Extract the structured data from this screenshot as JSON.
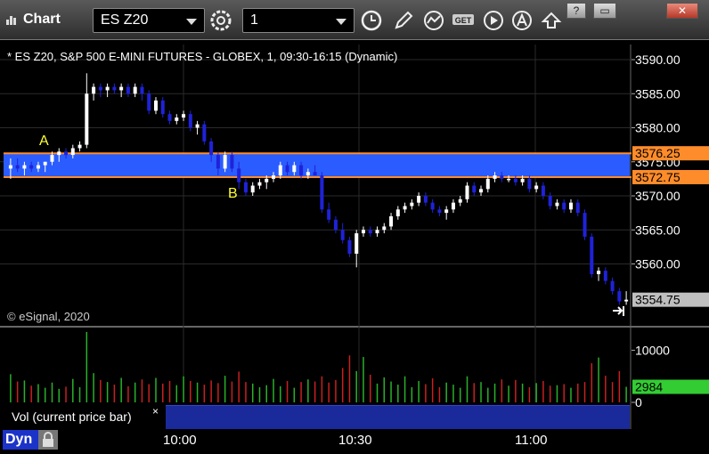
{
  "window": {
    "title": "Chart",
    "symbol_combo": "ES Z20",
    "interval_combo": "1",
    "buttons": [
      "gear-icon",
      "clock-icon",
      "pencil-icon",
      "study-icon",
      "get-icon",
      "play-icon",
      "a-icon",
      "arrow-icon"
    ],
    "win_controls": [
      "?",
      "▭",
      "✕"
    ]
  },
  "chart": {
    "info_line": "* ES Z20, S&P 500 E-MINI FUTURES - GLOBEX, 1, 09:30-16:15 (Dynamic)",
    "credit": "© eSignal, 2020",
    "annotations": {
      "a": "A",
      "b": "B"
    },
    "price_ticks": [
      "3590.00",
      "3585.00",
      "3580.00",
      "3575.00",
      "3570.00",
      "3565.00",
      "3560.00"
    ],
    "price_tick_values": [
      3590,
      3585,
      3580,
      3575,
      3570,
      3565,
      3560
    ],
    "band": {
      "upper": 3576.25,
      "lower": 3572.75,
      "upper_label": "3576.25",
      "lower_label": "3572.75"
    },
    "last_price": {
      "value": 3554.75,
      "label": "3554.75"
    },
    "colors": {
      "up": "#ffffff",
      "down": "#1f22d8",
      "band": "#2a5cff",
      "band_edge": "#ff8c2a",
      "vol_up": "#2ab02a",
      "vol_down": "#c82020",
      "grid": "#2a2a2a"
    }
  },
  "volume": {
    "label": "Vol (current price bar)",
    "close_glyph": "×",
    "ticks": [
      "10000",
      "0"
    ],
    "current_label": "2984"
  },
  "time_axis": {
    "labels": [
      "10:00",
      "10:30",
      "11:00"
    ],
    "mode_label": "Dyn"
  },
  "chart_data": {
    "type": "candlestick",
    "x_unit": "1-minute bars from 09:48",
    "ylim": [
      3553,
      3591
    ],
    "candles": [
      [
        3574.0,
        3575.5,
        3572.5,
        3574.5
      ],
      [
        3574.5,
        3575.5,
        3573.5,
        3574.0
      ],
      [
        3574.0,
        3575.0,
        3573.0,
        3574.5
      ],
      [
        3574.5,
        3575.0,
        3573.5,
        3574.0
      ],
      [
        3574.0,
        3575.0,
        3573.5,
        3574.5
      ],
      [
        3574.5,
        3575.0,
        3573.5,
        3575.0
      ],
      [
        3575.0,
        3576.5,
        3574.5,
        3576.0
      ],
      [
        3576.0,
        3577.0,
        3575.0,
        3576.5
      ],
      [
        3576.5,
        3577.0,
        3575.5,
        3576.0
      ],
      [
        3576.0,
        3577.5,
        3575.5,
        3577.0
      ],
      [
        3577.0,
        3578.0,
        3576.5,
        3577.5
      ],
      [
        3577.5,
        3588.0,
        3577.0,
        3585.0
      ],
      [
        3585.0,
        3586.5,
        3584.0,
        3586.0
      ],
      [
        3586.0,
        3586.5,
        3584.5,
        3585.5
      ],
      [
        3585.5,
        3586.5,
        3584.5,
        3586.0
      ],
      [
        3586.0,
        3586.5,
        3585.0,
        3585.5
      ],
      [
        3585.5,
        3586.5,
        3584.5,
        3586.0
      ],
      [
        3586.0,
        3586.5,
        3584.5,
        3585.0
      ],
      [
        3585.0,
        3586.5,
        3584.5,
        3586.0
      ],
      [
        3586.0,
        3586.5,
        3584.0,
        3585.0
      ],
      [
        3585.0,
        3585.5,
        3582.0,
        3582.5
      ],
      [
        3582.5,
        3584.5,
        3582.0,
        3584.0
      ],
      [
        3584.0,
        3584.5,
        3581.5,
        3582.0
      ],
      [
        3582.0,
        3582.5,
        3580.5,
        3581.0
      ],
      [
        3581.0,
        3582.0,
        3580.5,
        3581.5
      ],
      [
        3581.5,
        3582.5,
        3581.0,
        3582.0
      ],
      [
        3582.0,
        3582.5,
        3579.5,
        3580.0
      ],
      [
        3580.0,
        3581.0,
        3579.0,
        3580.5
      ],
      [
        3580.5,
        3581.0,
        3577.5,
        3578.0
      ],
      [
        3578.0,
        3578.5,
        3575.0,
        3576.0
      ],
      [
        3576.0,
        3576.5,
        3573.0,
        3574.0
      ],
      [
        3574.0,
        3576.5,
        3573.5,
        3576.0
      ],
      [
        3576.0,
        3576.5,
        3573.5,
        3574.0
      ],
      [
        3574.0,
        3575.0,
        3571.0,
        3572.0
      ],
      [
        3572.0,
        3572.5,
        3570.0,
        3570.5
      ],
      [
        3570.5,
        3572.0,
        3570.0,
        3571.5
      ],
      [
        3571.5,
        3572.5,
        3571.0,
        3572.0
      ],
      [
        3572.0,
        3573.0,
        3571.0,
        3572.5
      ],
      [
        3572.5,
        3573.5,
        3572.0,
        3573.0
      ],
      [
        3573.0,
        3575.0,
        3572.5,
        3574.5
      ],
      [
        3574.5,
        3575.0,
        3573.0,
        3573.5
      ],
      [
        3573.5,
        3575.0,
        3573.0,
        3574.5
      ],
      [
        3574.5,
        3575.0,
        3572.5,
        3573.0
      ],
      [
        3573.0,
        3574.0,
        3572.5,
        3573.5
      ],
      [
        3573.5,
        3574.5,
        3573.0,
        3573.0
      ],
      [
        3573.0,
        3573.5,
        3567.5,
        3568.0
      ],
      [
        3568.0,
        3569.0,
        3566.0,
        3566.5
      ],
      [
        3566.5,
        3567.0,
        3564.5,
        3565.0
      ],
      [
        3565.0,
        3566.0,
        3563.0,
        3563.5
      ],
      [
        3563.5,
        3564.0,
        3561.0,
        3561.5
      ],
      [
        3561.5,
        3565.0,
        3559.5,
        3564.5
      ],
      [
        3564.5,
        3565.5,
        3564.0,
        3565.0
      ],
      [
        3565.0,
        3565.5,
        3564.0,
        3564.5
      ],
      [
        3564.5,
        3565.5,
        3564.0,
        3565.0
      ],
      [
        3565.0,
        3566.0,
        3564.5,
        3565.5
      ],
      [
        3565.5,
        3567.5,
        3565.0,
        3567.0
      ],
      [
        3567.0,
        3568.5,
        3566.5,
        3568.0
      ],
      [
        3568.0,
        3569.0,
        3567.5,
        3568.5
      ],
      [
        3568.5,
        3569.5,
        3568.0,
        3569.0
      ],
      [
        3569.0,
        3570.5,
        3568.5,
        3570.0
      ],
      [
        3570.0,
        3570.5,
        3568.5,
        3569.0
      ],
      [
        3569.0,
        3569.5,
        3567.5,
        3568.0
      ],
      [
        3568.0,
        3568.5,
        3567.0,
        3567.5
      ],
      [
        3567.5,
        3568.5,
        3566.5,
        3568.0
      ],
      [
        3568.0,
        3569.5,
        3567.5,
        3569.0
      ],
      [
        3569.0,
        3570.0,
        3568.5,
        3569.5
      ],
      [
        3569.5,
        3572.0,
        3569.0,
        3571.5
      ],
      [
        3571.5,
        3572.0,
        3570.0,
        3570.5
      ],
      [
        3570.5,
        3571.5,
        3570.0,
        3571.0
      ],
      [
        3571.0,
        3573.0,
        3570.5,
        3572.5
      ],
      [
        3572.5,
        3573.5,
        3572.0,
        3573.0
      ],
      [
        3573.0,
        3573.5,
        3572.0,
        3572.5
      ],
      [
        3572.5,
        3573.0,
        3572.0,
        3572.5
      ],
      [
        3572.5,
        3573.0,
        3571.5,
        3572.0
      ],
      [
        3572.0,
        3573.0,
        3571.5,
        3572.5
      ],
      [
        3572.5,
        3573.0,
        3570.5,
        3571.0
      ],
      [
        3571.0,
        3572.0,
        3570.5,
        3571.5
      ],
      [
        3571.5,
        3572.0,
        3569.5,
        3570.0
      ],
      [
        3570.0,
        3570.5,
        3568.0,
        3568.5
      ],
      [
        3568.5,
        3569.5,
        3568.0,
        3569.0
      ],
      [
        3569.0,
        3569.5,
        3567.5,
        3568.0
      ],
      [
        3568.0,
        3569.5,
        3567.5,
        3569.0
      ],
      [
        3569.0,
        3569.5,
        3567.0,
        3567.5
      ],
      [
        3567.5,
        3568.0,
        3563.5,
        3564.0
      ],
      [
        3564.0,
        3564.5,
        3558.0,
        3558.5
      ],
      [
        3558.5,
        3559.5,
        3557.5,
        3559.0
      ],
      [
        3559.0,
        3559.5,
        3557.0,
        3557.5
      ],
      [
        3557.5,
        3558.0,
        3555.5,
        3556.0
      ],
      [
        3556.0,
        3556.5,
        3554.0,
        3554.5
      ],
      [
        3554.5,
        3556.0,
        3554.0,
        3554.75
      ]
    ],
    "volumes": [
      5400,
      4000,
      4200,
      3200,
      3500,
      2800,
      3800,
      2600,
      3000,
      4500,
      2900,
      13500,
      5600,
      4300,
      3900,
      3400,
      4700,
      3100,
      3800,
      4400,
      3500,
      4700,
      3600,
      4100,
      3300,
      5000,
      4100,
      3800,
      3400,
      4200,
      3700,
      5100,
      4000,
      5900,
      3900,
      3600,
      2900,
      3300,
      4500,
      3100,
      4100,
      2800,
      3900,
      4400,
      4000,
      5000,
      3800,
      4300,
      6600,
      9000,
      6000,
      8700,
      5300,
      3600,
      4800,
      4000,
      3400,
      5000,
      2900,
      4100,
      3500,
      4600,
      2900,
      3800,
      3400,
      2800,
      5000,
      3700,
      3900,
      2800,
      3600,
      4400,
      3200,
      4300,
      3600,
      2900,
      3700,
      4100,
      3200,
      3300,
      3500,
      2800,
      3600,
      3900,
      7500,
      8600,
      5100,
      3900,
      6000,
      2984
    ],
    "vol_ylim": [
      0,
      14000
    ]
  }
}
